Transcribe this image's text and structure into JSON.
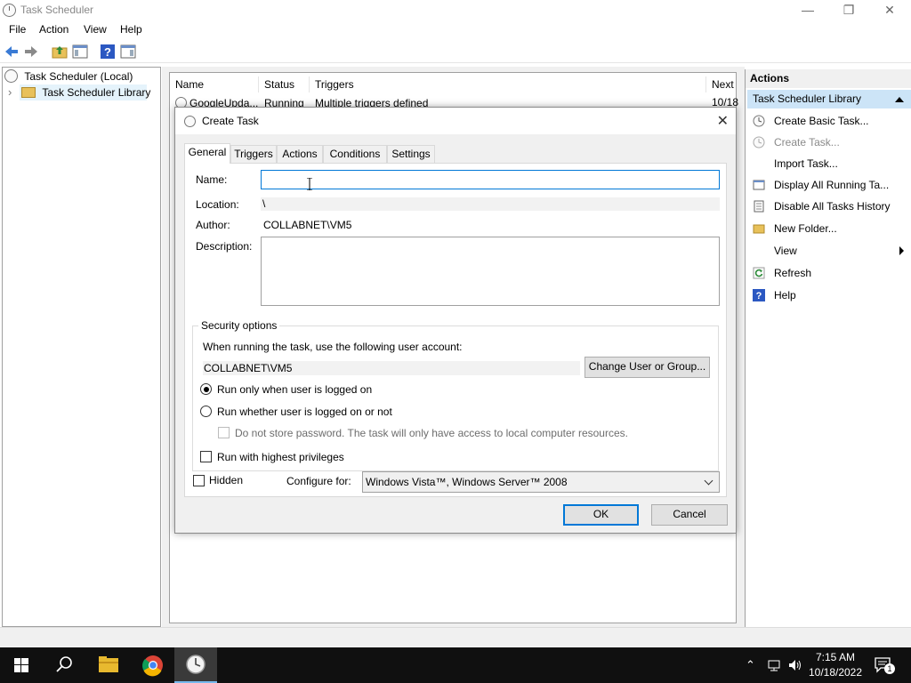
{
  "window": {
    "title": "Task Scheduler",
    "minimize_glyph": "—",
    "restore_glyph": "❐",
    "close_glyph": "✕"
  },
  "menu": {
    "file": "File",
    "action": "Action",
    "view": "View",
    "help": "Help"
  },
  "toolbar": {
    "icons": [
      "back-arrow-icon",
      "forward-arrow-icon",
      "folder-up-icon",
      "show-hide-console-tree-icon",
      "help-icon",
      "show-hide-action-pane-icon"
    ]
  },
  "tree": {
    "root": "Task Scheduler (Local)",
    "library": "Task Scheduler Library",
    "expander": "›"
  },
  "task_list": {
    "columns": [
      "Name",
      "Status",
      "Triggers",
      "Next"
    ],
    "rows": [
      {
        "name": "GoogleUpda...",
        "status": "Running",
        "triggers": "Multiple triggers defined",
        "next": "10/18"
      }
    ]
  },
  "actions": {
    "header": "Actions",
    "section": "Task Scheduler Library",
    "items": [
      {
        "label": "Create Basic Task...",
        "icon": "create-basic-task-icon",
        "disabled": false
      },
      {
        "label": "Create Task...",
        "icon": "create-task-icon",
        "disabled": true
      },
      {
        "label": "Import Task...",
        "icon": "",
        "disabled": false
      },
      {
        "label": "Display All Running Ta...",
        "icon": "running-tasks-icon",
        "disabled": false
      },
      {
        "label": "Disable All Tasks History",
        "icon": "history-icon",
        "disabled": false
      },
      {
        "label": "New Folder...",
        "icon": "folder-icon",
        "disabled": false
      },
      {
        "label": "View",
        "icon": "",
        "disabled": false,
        "submenu": true
      },
      {
        "label": "Refresh",
        "icon": "refresh-icon",
        "disabled": false
      },
      {
        "label": "Help",
        "icon": "help-icon",
        "disabled": false
      }
    ]
  },
  "dialog": {
    "title": "Create Task",
    "close_glyph": "✕",
    "tabs": [
      "General",
      "Triggers",
      "Actions",
      "Conditions",
      "Settings"
    ],
    "active_tab": "General",
    "name_label": "Name:",
    "name_value": "",
    "location_label": "Location:",
    "location_value": "\\",
    "author_label": "Author:",
    "author_value": "COLLABNET\\VM5",
    "description_label": "Description:",
    "description_value": "",
    "security": {
      "title": "Security options",
      "account_prompt": "When running the task, use the following user account:",
      "account_value": "COLLABNET\\VM5",
      "change_button": "Change User or Group...",
      "radio_logged_on": "Run only when user is logged on",
      "radio_whether": "Run whether user is logged on or not",
      "no_store_password": "Do not store password.  The task will only have access to local computer resources.",
      "highest_privileges": "Run with highest privileges",
      "selected_radio": "logged_on"
    },
    "hidden_label": "Hidden",
    "configure_label": "Configure for:",
    "configure_value": "Windows Vista™, Windows Server™ 2008",
    "ok_button": "OK",
    "cancel_button": "Cancel"
  },
  "taskbar": {
    "time": "7:15 AM",
    "date": "10/18/2022",
    "notification_count": "1",
    "items": [
      "start-icon",
      "search-icon",
      "file-explorer-icon",
      "chrome-icon",
      "task-scheduler-icon"
    ]
  },
  "colors": {
    "accent": "#0078d7",
    "selection": "#cce4f7",
    "taskbar": "#101010"
  }
}
